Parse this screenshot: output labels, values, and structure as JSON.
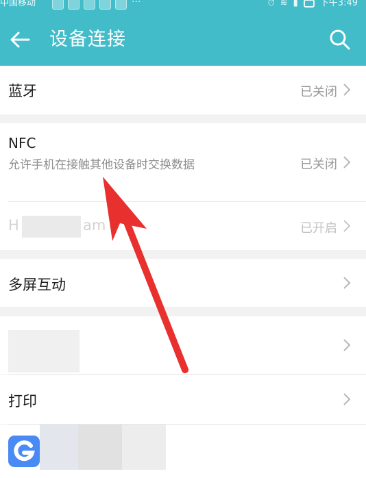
{
  "status_bar": {
    "carrier": "中国移动",
    "more": "···",
    "time": "下午3:49",
    "app_icon_names": [
      "app-icon-1",
      "app-icon-2",
      "app-icon-3",
      "app-icon-4",
      "app-icon-5"
    ]
  },
  "toolbar": {
    "title": "设备连接",
    "back_icon": "back-arrow-icon",
    "search_icon": "search-icon",
    "color": "#42bcc9"
  },
  "rows": {
    "bluetooth": {
      "label": "蓝牙",
      "value": "已关闭"
    },
    "nfc": {
      "label": "NFC",
      "subtitle": "允许手机在接触其他设备时交换数据",
      "value": "已关闭"
    },
    "huawei_beam": {
      "label_start": "H",
      "label_end": "am",
      "value": "已开启"
    },
    "multiscreen": {
      "label": "多屏互动"
    },
    "print": {
      "label": "打印"
    }
  },
  "annotation": {
    "color": "#e8302f"
  }
}
